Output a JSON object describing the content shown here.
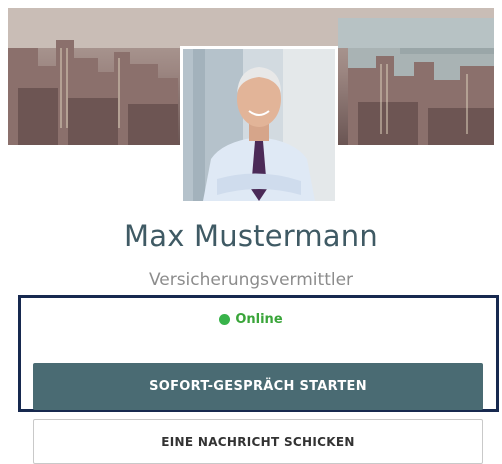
{
  "profile": {
    "name": "Max Mustermann",
    "title": "Versicherungsvermittler"
  },
  "status": {
    "label": "Online",
    "color": "#38b34a"
  },
  "actions": {
    "primary_label": "SOFORT-GESPRÄCH STARTEN",
    "secondary_label": "EINE NACHRICHT SCHICKEN"
  },
  "colors": {
    "primary_button": "#4a6b73",
    "name_text": "#3f5a64",
    "highlight_border": "#17294f"
  }
}
